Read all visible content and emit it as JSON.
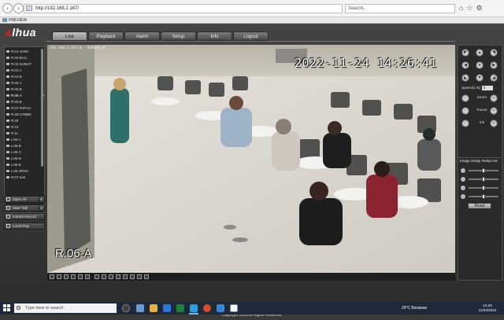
{
  "browser": {
    "url": "http://192.168.2.167/",
    "search_placeholder": "Search...",
    "tab_title": "PREVIEW"
  },
  "app": {
    "logo_main": "a",
    "logo_rest": "lhua",
    "nav": [
      "Live",
      "Playback",
      "Alarm",
      "Setup",
      "Info",
      "Logout"
    ],
    "active_nav": "Live",
    "footer": "Copyright 2015,All Rights Reserved."
  },
  "sidebar": {
    "cameras": [
      "R.01-JAWA",
      "R.02-BALI",
      "R.03-SUMAT",
      "R.04-A",
      "R.04-B",
      "R.05-A",
      "R.05-B",
      "R.06-A",
      "R.06-B",
      "R.07-PAPUA",
      "R.08-LOMBK",
      "R.09",
      "R.10",
      "R.11",
      "LAB-A",
      "LAB-B",
      "LAB-C",
      "LAB-D",
      "LAB-E",
      "LAB-JRGN",
      "R.07-ILM"
    ],
    "active_camera": "R.06-A",
    "active_marker": "M"
  },
  "sidebar_buttons": {
    "open_all": "Open All",
    "start_talk": "Start Talk",
    "instant_record": "Instant Record",
    "local_play": "Local Play"
  },
  "video": {
    "osd_info": "192.168.2.167_0_ 785Kbps_M",
    "timestamp": "2022-11-24 14:26:41",
    "camera_name": "R.06-A"
  },
  "ptz": {
    "speed_label": "Speed(1-8)",
    "speed_value": "5",
    "zoom_label": "Zoom",
    "focus_label": "Focus",
    "iris_label": "Iris"
  },
  "image_panel": {
    "tab_image_setup": "Image Setup",
    "tab_relay_out": "Relay-out",
    "sliders": [
      {
        "name": "brightness",
        "level": 0.5
      },
      {
        "name": "contrast",
        "level": 0.5
      },
      {
        "name": "saturation",
        "level": 0.5
      },
      {
        "name": "hue",
        "level": 0.5
      }
    ],
    "reset_label": "Reset"
  },
  "taskbar": {
    "search_placeholder": "Type here to search",
    "weather": "29°C  Berawan",
    "time": "14:26",
    "date": "11/24/2022"
  }
}
